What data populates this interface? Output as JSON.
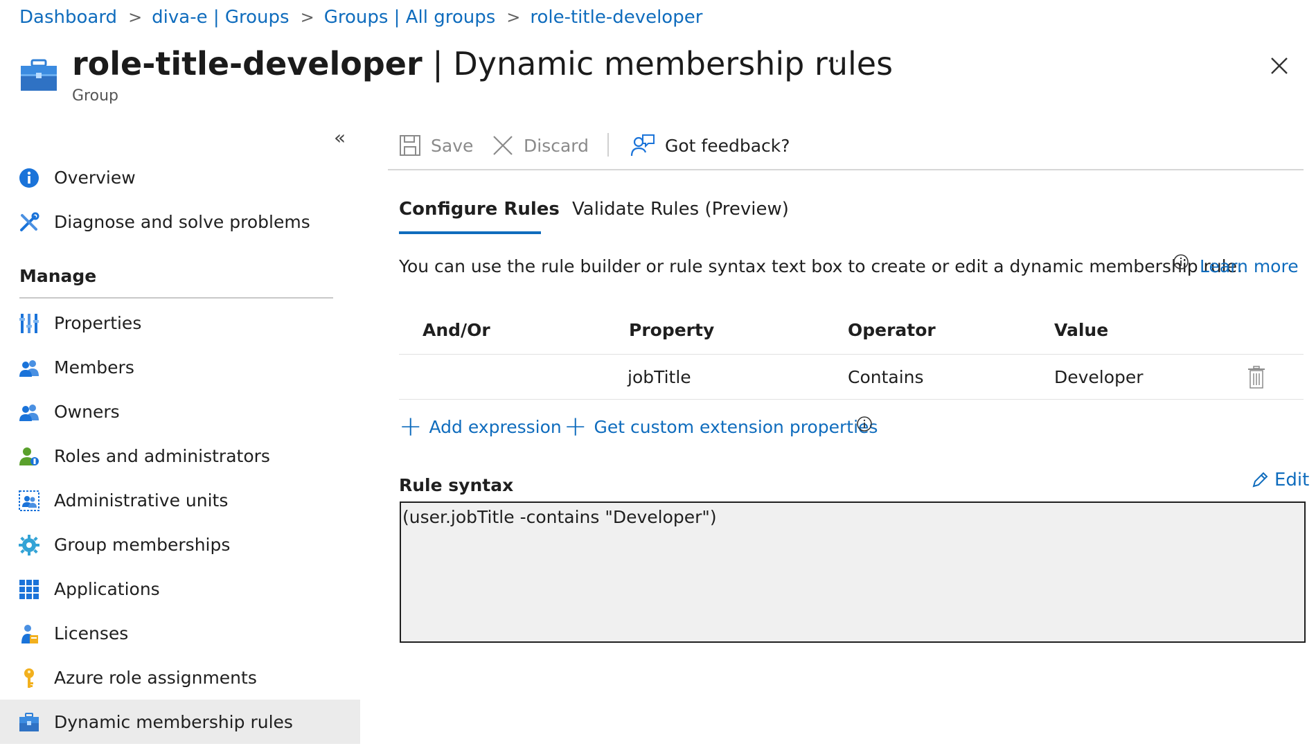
{
  "breadcrumb": {
    "items": [
      "Dashboard",
      "diva-e | Groups",
      "Groups | All groups",
      "role-title-developer"
    ],
    "separator": ">"
  },
  "header": {
    "title_bold": "role-title-developer",
    "title_rest": " | Dynamic membership rules",
    "subtitle": "Group",
    "more": "···"
  },
  "sidebar": {
    "collapse": "«",
    "top_items": [
      {
        "label": "Overview",
        "icon": "info-icon"
      },
      {
        "label": "Diagnose and solve problems",
        "icon": "wrench-icon"
      }
    ],
    "manage_heading": "Manage",
    "manage_items": [
      {
        "label": "Properties",
        "icon": "properties-icon"
      },
      {
        "label": "Members",
        "icon": "members-icon"
      },
      {
        "label": "Owners",
        "icon": "owners-icon"
      },
      {
        "label": "Roles and administrators",
        "icon": "roles-icon"
      },
      {
        "label": "Administrative units",
        "icon": "admin-units-icon"
      },
      {
        "label": "Group memberships",
        "icon": "gear-icon"
      },
      {
        "label": "Applications",
        "icon": "grid-icon"
      },
      {
        "label": "Licenses",
        "icon": "license-icon"
      },
      {
        "label": "Azure role assignments",
        "icon": "key-icon"
      },
      {
        "label": "Dynamic membership rules",
        "icon": "toolbox-icon",
        "active": true
      }
    ]
  },
  "toolbar": {
    "save_label": "Save",
    "discard_label": "Discard",
    "feedback_label": "Got feedback?"
  },
  "tabs": [
    {
      "label": "Configure Rules",
      "active": true
    },
    {
      "label": "Validate Rules (Preview)",
      "active": false
    }
  ],
  "description": {
    "text": "You can use the rule builder or rule syntax text box to create or edit a dynamic membership rule.",
    "learn_more": "Learn more"
  },
  "rules_table": {
    "columns": [
      "And/Or",
      "Property",
      "Operator",
      "Value"
    ],
    "rows": [
      {
        "and_or": "",
        "property": "jobTitle",
        "operator": "Contains",
        "value": "Developer"
      }
    ]
  },
  "actions": {
    "add_expression": "Add expression",
    "custom_extension": "Get custom extension properties"
  },
  "rule_syntax": {
    "label": "Rule syntax",
    "edit_label": "Edit",
    "value": "(user.jobTitle -contains \"Developer\")"
  },
  "colors": {
    "link": "#0f6cbd",
    "active_nav_bg": "#ebebeb",
    "syntax_bg": "#f0f0f0"
  }
}
